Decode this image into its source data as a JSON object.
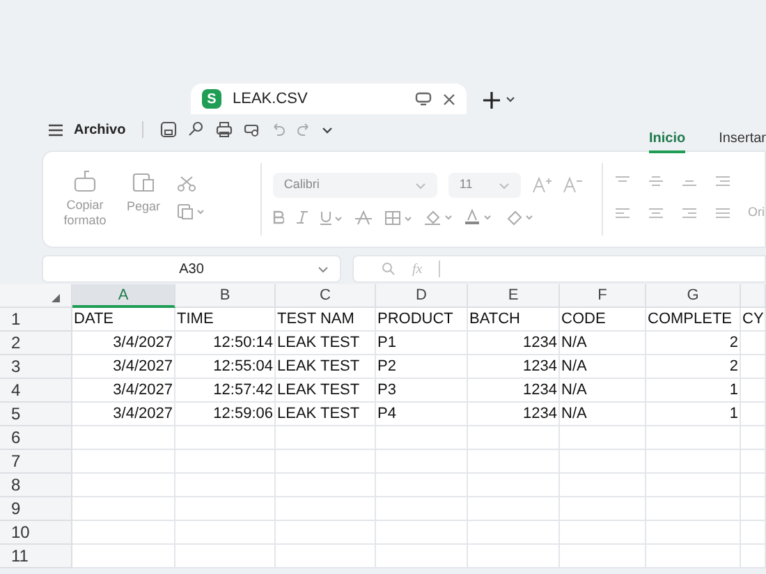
{
  "file_tab": {
    "badge": "S",
    "title": "LEAK.CSV"
  },
  "menu": {
    "label": "Archivo"
  },
  "ribbon_tabs": [
    {
      "label": "Inicio",
      "selected": true
    },
    {
      "label": "Insertar",
      "selected": false
    }
  ],
  "clipboard": {
    "format_painter": "Copiar formato",
    "paste": "Pegar"
  },
  "font": {
    "name": "Calibri",
    "size": "11"
  },
  "alignment_cut_label": "Ori",
  "name_box": "A30",
  "formula_bar": {
    "label": "fx"
  },
  "columns": [
    {
      "label": "A",
      "selected": true
    },
    {
      "label": "B",
      "selected": false
    },
    {
      "label": "C",
      "selected": false
    },
    {
      "label": "D",
      "selected": false
    },
    {
      "label": "E",
      "selected": false
    },
    {
      "label": "F",
      "selected": false
    },
    {
      "label": "G",
      "selected": false
    }
  ],
  "rows": [
    {
      "number": "1",
      "cells": [
        {
          "text": "DATE",
          "kind": "text"
        },
        {
          "text": "TIME",
          "kind": "text"
        },
        {
          "text": "TEST NAM",
          "kind": "text"
        },
        {
          "text": "PRODUCT",
          "kind": "text"
        },
        {
          "text": "BATCH",
          "kind": "text"
        },
        {
          "text": "CODE",
          "kind": "text"
        },
        {
          "text": "COMPLETE",
          "kind": "text"
        },
        {
          "text": "CY",
          "kind": "text"
        }
      ]
    },
    {
      "number": "2",
      "cells": [
        {
          "text": "3/4/2027",
          "kind": "number"
        },
        {
          "text": "12:50:14",
          "kind": "number"
        },
        {
          "text": "LEAK TEST",
          "kind": "text"
        },
        {
          "text": "P1",
          "kind": "text"
        },
        {
          "text": "1234",
          "kind": "number"
        },
        {
          "text": "N/A",
          "kind": "text"
        },
        {
          "text": "2",
          "kind": "number"
        }
      ]
    },
    {
      "number": "3",
      "cells": [
        {
          "text": "3/4/2027",
          "kind": "number"
        },
        {
          "text": "12:55:04",
          "kind": "number"
        },
        {
          "text": "LEAK TEST",
          "kind": "text"
        },
        {
          "text": "P2",
          "kind": "text"
        },
        {
          "text": "1234",
          "kind": "number"
        },
        {
          "text": "N/A",
          "kind": "text"
        },
        {
          "text": "2",
          "kind": "number"
        }
      ]
    },
    {
      "number": "4",
      "cells": [
        {
          "text": "3/4/2027",
          "kind": "number"
        },
        {
          "text": "12:57:42",
          "kind": "number"
        },
        {
          "text": "LEAK TEST",
          "kind": "text"
        },
        {
          "text": "P3",
          "kind": "text"
        },
        {
          "text": "1234",
          "kind": "number"
        },
        {
          "text": "N/A",
          "kind": "text"
        },
        {
          "text": "1",
          "kind": "number"
        }
      ]
    },
    {
      "number": "5",
      "cells": [
        {
          "text": "3/4/2027",
          "kind": "number"
        },
        {
          "text": "12:59:06",
          "kind": "number"
        },
        {
          "text": "LEAK TEST",
          "kind": "text"
        },
        {
          "text": "P4",
          "kind": "text"
        },
        {
          "text": "1234",
          "kind": "number"
        },
        {
          "text": "N/A",
          "kind": "text"
        },
        {
          "text": "1",
          "kind": "number"
        }
      ]
    },
    {
      "number": "6",
      "cells": []
    },
    {
      "number": "7",
      "cells": []
    },
    {
      "number": "8",
      "cells": []
    },
    {
      "number": "9",
      "cells": []
    },
    {
      "number": "10",
      "cells": []
    },
    {
      "number": "11",
      "cells": []
    }
  ]
}
